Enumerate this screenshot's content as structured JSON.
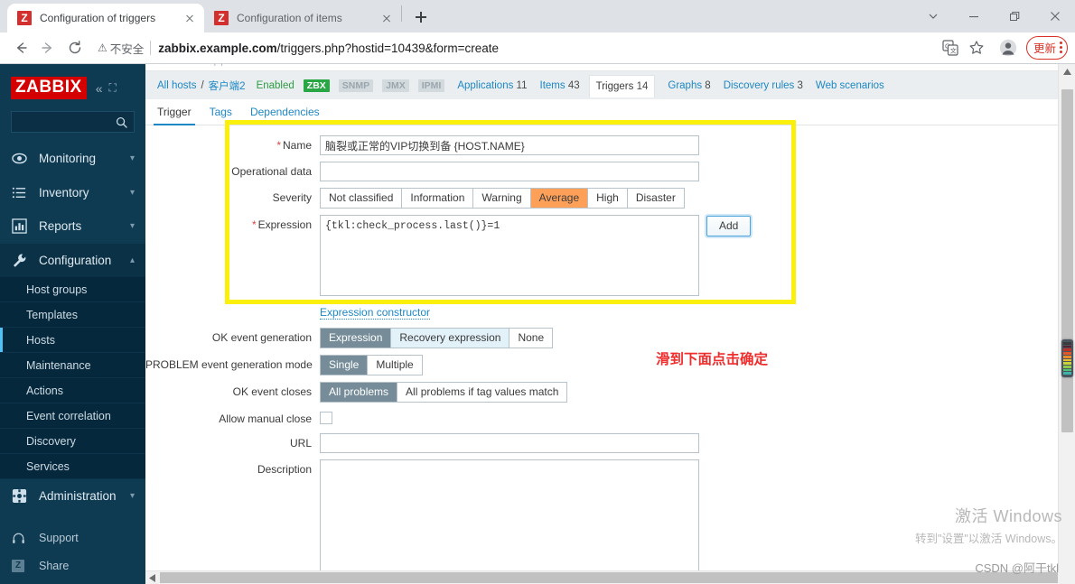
{
  "browser": {
    "tabs": [
      {
        "title": "Configuration of triggers",
        "favicon": "zabbix-z-icon",
        "active": true
      },
      {
        "title": "Configuration of items",
        "favicon": "zabbix-z-icon",
        "active": false
      }
    ],
    "new_tab_label": "+",
    "window_controls": [
      "tab-search-chevron",
      "minimize",
      "restore",
      "close"
    ],
    "toolbar": {
      "back": "back-arrow-icon",
      "forward": "forward-arrow-icon",
      "reload": "reload-icon",
      "insecure_label": "不安全",
      "url_domain": "zabbix.example.com",
      "url_path": "/triggers.php?hostid=10439&form=create",
      "translate_icon": "translate-icon",
      "bookmark_icon": "star-icon",
      "profile_icon": "profile-avatar-icon",
      "update_label": "更新",
      "menu_icon": "kebab-menu-icon"
    }
  },
  "sidebar": {
    "logo": "ZABBIX",
    "collapse_icon": "chevron-double-left-icon",
    "pin_icon": "collapse-panel-icon",
    "search_placeholder": "",
    "search_icon": "search-icon",
    "nav": [
      {
        "label": "Monitoring",
        "icon": "eye-icon",
        "caret": "chevron-down-icon",
        "open": false
      },
      {
        "label": "Inventory",
        "icon": "list-icon",
        "caret": "chevron-down-icon",
        "open": false
      },
      {
        "label": "Reports",
        "icon": "bar-chart-icon",
        "caret": "chevron-down-icon",
        "open": false
      },
      {
        "label": "Configuration",
        "icon": "wrench-icon",
        "caret": "chevron-up-icon",
        "open": true
      }
    ],
    "config_children": [
      {
        "label": "Host groups",
        "active": false
      },
      {
        "label": "Templates",
        "active": false
      },
      {
        "label": "Hosts",
        "active": true
      },
      {
        "label": "Maintenance",
        "active": false
      },
      {
        "label": "Actions",
        "active": false
      },
      {
        "label": "Event correlation",
        "active": false
      },
      {
        "label": "Discovery",
        "active": false
      },
      {
        "label": "Services",
        "active": false
      }
    ],
    "administration": {
      "label": "Administration",
      "icon": "gear-icon",
      "caret": "chevron-down-icon"
    },
    "footer": [
      {
        "label": "Support",
        "icon": "headset-icon"
      },
      {
        "label": "Share",
        "icon": "zabbix-share-icon"
      }
    ]
  },
  "header": {
    "breadcrumb_root": "All hosts",
    "breadcrumb_sep": "/",
    "breadcrumb_host": "客户端2",
    "status": "Enabled",
    "interfaces": [
      {
        "label": "ZBX",
        "enabled": true
      },
      {
        "label": "SNMP",
        "enabled": false
      },
      {
        "label": "JMX",
        "enabled": false
      },
      {
        "label": "IPMI",
        "enabled": false
      }
    ],
    "links": [
      {
        "label": "Applications",
        "count": "11",
        "selected": false
      },
      {
        "label": "Items",
        "count": "43",
        "selected": false
      },
      {
        "label": "Triggers",
        "count": "14",
        "selected": true
      },
      {
        "label": "Graphs",
        "count": "8",
        "selected": false
      },
      {
        "label": "Discovery rules",
        "count": "3",
        "selected": false
      },
      {
        "label": "Web scenarios",
        "count": "",
        "selected": false
      }
    ]
  },
  "form_tabs": [
    {
      "label": "Trigger",
      "active": true
    },
    {
      "label": "Tags",
      "active": false
    },
    {
      "label": "Dependencies",
      "active": false
    }
  ],
  "form": {
    "name": {
      "label": "Name",
      "required": true,
      "value": "脑裂或正常的VIP切换到备 {HOST.NAME}"
    },
    "operational_data": {
      "label": "Operational data",
      "required": false,
      "value": ""
    },
    "severity": {
      "label": "Severity",
      "options": [
        "Not classified",
        "Information",
        "Warning",
        "Average",
        "High",
        "Disaster"
      ],
      "selected": "Average"
    },
    "expression": {
      "label": "Expression",
      "required": true,
      "value": "{tkl:check_process.last()}=1",
      "add_button": "Add"
    },
    "expression_constructor": "Expression constructor",
    "ok_event_generation": {
      "label": "OK event generation",
      "options": [
        "Expression",
        "Recovery expression",
        "None"
      ],
      "selected": "Expression",
      "hovered": "Recovery expression"
    },
    "problem_event_generation_mode": {
      "label": "PROBLEM event generation mode",
      "options": [
        "Single",
        "Multiple"
      ],
      "selected": "Single"
    },
    "ok_event_closes": {
      "label": "OK event closes",
      "options": [
        "All problems",
        "All problems if tag values match"
      ],
      "selected": "All problems"
    },
    "allow_manual_close": {
      "label": "Allow manual close",
      "checked": false
    },
    "url": {
      "label": "URL",
      "value": ""
    },
    "description": {
      "label": "Description",
      "value": ""
    }
  },
  "annotation": "滑到下面点击确定",
  "watermark": {
    "line1": "激活 Windows",
    "line2": "转到\"设置\"以激活 Windows。"
  },
  "credit": "CSDN @阿干tkl",
  "colors": {
    "zabbix_red": "#d40000",
    "sidebar_bg": "#0e3a52",
    "link_blue": "#1e87c4",
    "severity_average": "#ffa059",
    "segment_selected": "#768d99",
    "highlight_yellow": "#fbf00b",
    "annotation_red": "#ef2d2d",
    "enabled_green": "#2e9c45",
    "update_red": "#d93025"
  }
}
